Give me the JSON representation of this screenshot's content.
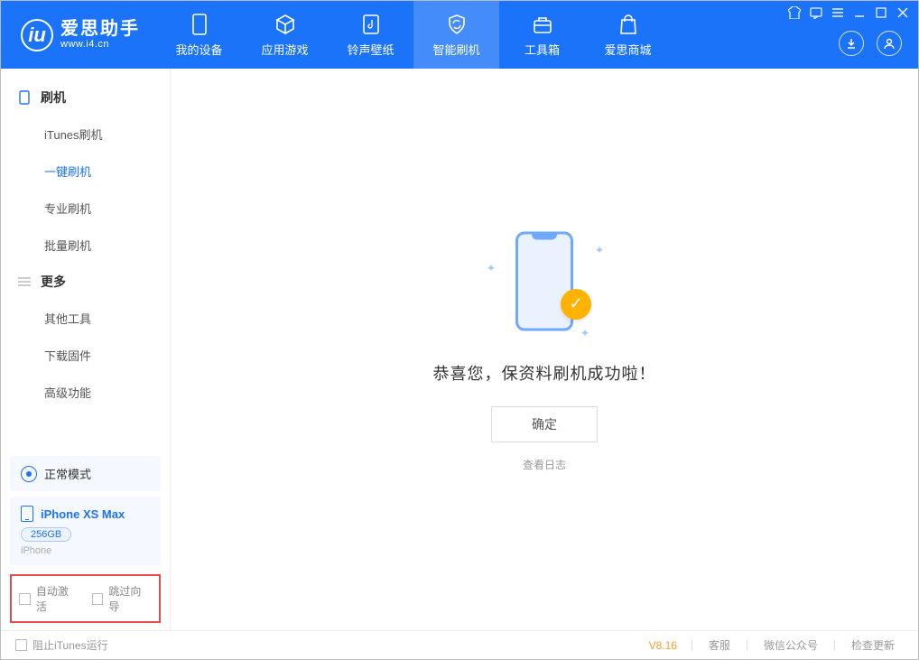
{
  "app": {
    "title": "爱思助手",
    "subtitle": "www.i4.cn"
  },
  "nav": [
    {
      "label": "我的设备"
    },
    {
      "label": "应用游戏"
    },
    {
      "label": "铃声壁纸"
    },
    {
      "label": "智能刷机"
    },
    {
      "label": "工具箱"
    },
    {
      "label": "爱思商城"
    }
  ],
  "sidebar": {
    "section1": {
      "title": "刷机",
      "items": [
        "iTunes刷机",
        "一键刷机",
        "专业刷机",
        "批量刷机"
      ]
    },
    "section2": {
      "title": "更多",
      "items": [
        "其他工具",
        "下载固件",
        "高级功能"
      ]
    },
    "status": "正常模式",
    "device": {
      "name": "iPhone XS Max",
      "storage": "256GB",
      "type": "iPhone"
    },
    "checkboxes": {
      "auto_activate": "自动激活",
      "skip_guide": "跳过向导"
    }
  },
  "main": {
    "success_message": "恭喜您，保资料刷机成功啦！",
    "ok_button": "确定",
    "view_log": "查看日志"
  },
  "footer": {
    "block_itunes": "阻止iTunes运行",
    "version": "V8.16",
    "links": [
      "客服",
      "微信公众号",
      "检查更新"
    ]
  }
}
